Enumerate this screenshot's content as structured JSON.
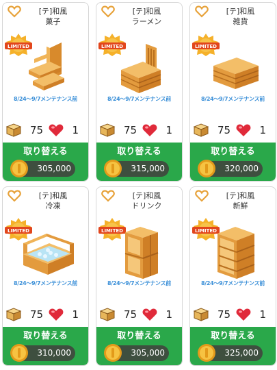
{
  "items": [
    {
      "category": "[テ]和風",
      "name": "菓子",
      "badge": "LIMITED",
      "notice": "8/24～9/7メンテナンス前",
      "qty": "75",
      "count": "1",
      "button": "取り替える",
      "price": "305,000",
      "furniture": "shelf-step"
    },
    {
      "category": "[テ]和風",
      "name": "ラーメン",
      "badge": "LIMITED",
      "notice": "8/24～9/7メンテナンス前",
      "qty": "75",
      "count": "1",
      "button": "取り替える",
      "price": "315,000",
      "furniture": "counter-chair"
    },
    {
      "category": "[テ]和風",
      "name": "雑貨",
      "badge": "LIMITED",
      "notice": "8/24～9/7メンテナンス前",
      "qty": "75",
      "count": "1",
      "button": "取り替える",
      "price": "320,000",
      "furniture": "low-table"
    },
    {
      "category": "[テ]和風",
      "name": "冷凍",
      "badge": "LIMITED",
      "notice": "8/24～9/7メンテナンス前",
      "qty": "75",
      "count": "1",
      "button": "取り替える",
      "price": "310,000",
      "furniture": "freezer-case"
    },
    {
      "category": "[テ]和風",
      "name": "ドリンク",
      "badge": "LIMITED",
      "notice": "8/24～9/7メンテナンス前",
      "qty": "75",
      "count": "1",
      "button": "取り替える",
      "price": "305,000",
      "furniture": "tall-shelf"
    },
    {
      "category": "[テ]和風",
      "name": "新鮮",
      "badge": "LIMITED",
      "notice": "8/24～9/7メンテナンス前",
      "qty": "75",
      "count": "1",
      "button": "取り替える",
      "price": "325,000",
      "furniture": "rack"
    }
  ],
  "colors": {
    "accent_green": "#2aa84a",
    "heart_red": "#e02a3a",
    "wood": "#e9a641",
    "notice_blue": "#3a8fd8",
    "limited_orange": "#f08a1c"
  },
  "icons": {
    "favorite": "heart-outline-icon",
    "material": "wood-box-icon",
    "life": "red-heart-icon",
    "currency": "gold-coin-icon"
  }
}
